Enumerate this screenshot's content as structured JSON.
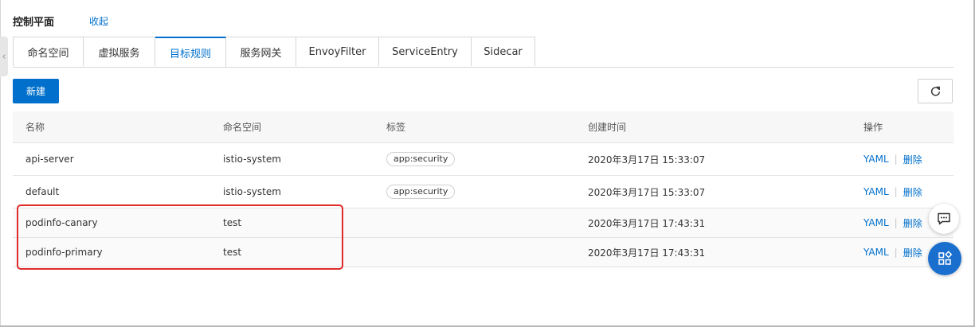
{
  "header": {
    "title": "控制平面",
    "collapse_label": "收起"
  },
  "tabs": [
    {
      "label": "命名空间"
    },
    {
      "label": "虚拟服务"
    },
    {
      "label": "目标规则",
      "active": true
    },
    {
      "label": "服务网关"
    },
    {
      "label": "EnvoyFilter"
    },
    {
      "label": "ServiceEntry"
    },
    {
      "label": "Sidecar"
    }
  ],
  "toolbar": {
    "new_label": "新建",
    "refresh_icon": "refresh-icon"
  },
  "table": {
    "columns": [
      "名称",
      "命名空间",
      "标签",
      "创建时间",
      "操作"
    ],
    "rows": [
      {
        "name": "api-server",
        "namespace": "istio-system",
        "tag": "app:security",
        "created": "2020年3月17日 15:33:07",
        "yaml": "YAML",
        "delete": "删除"
      },
      {
        "name": "default",
        "namespace": "istio-system",
        "tag": "app:security",
        "created": "2020年3月17日 15:33:07",
        "yaml": "YAML",
        "delete": "删除"
      },
      {
        "name": "podinfo-canary",
        "namespace": "test",
        "tag": "",
        "created": "2020年3月17日 17:43:31",
        "yaml": "YAML",
        "delete": "删除"
      },
      {
        "name": "podinfo-primary",
        "namespace": "test",
        "tag": "",
        "created": "2020年3月17日 17:43:31",
        "yaml": "YAML",
        "delete": "删除"
      }
    ]
  },
  "annotation": {
    "color": "#e02a2a"
  },
  "floating": {
    "chat_icon": "chat-icon",
    "apps_icon": "apps-icon"
  },
  "colors": {
    "accent": "#0070cc",
    "tab_active": "#0070cc"
  }
}
